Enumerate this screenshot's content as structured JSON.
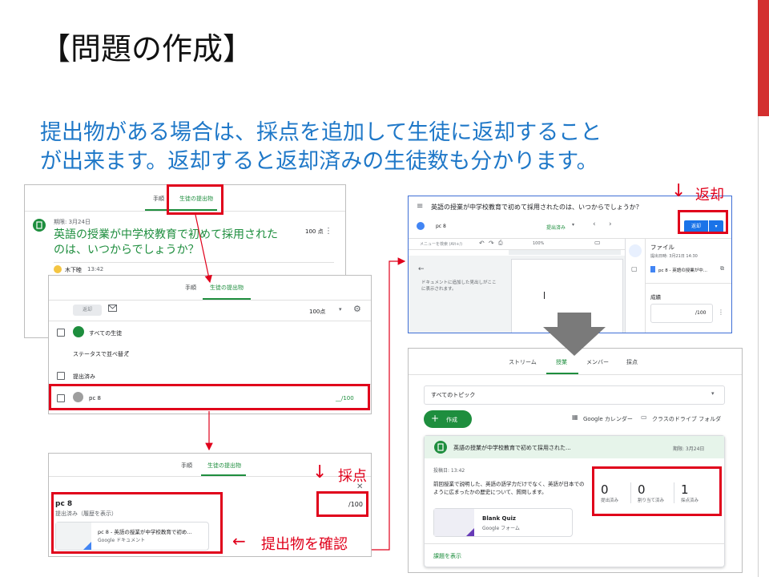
{
  "slide": {
    "title": "【問題の作成】",
    "body_line1": "提出物がある場合は、採点を追加して生徒に返却すること",
    "body_line2": "が出来ます。返却すると返却済みの生徒数も分かります。",
    "accent_color": "#d32f2f"
  },
  "shot1": {
    "tab_instructions": "手順",
    "tab_submissions": "生徒の提出物",
    "due": "期限: 3月24日",
    "title_line1": "英語の授業が中学校教育で初めて採用された",
    "title_line2": "のは、いつからでしょうか？",
    "points": "100 点",
    "author": "木下睦",
    "time": "13:42"
  },
  "shot2": {
    "tab_instructions": "手順",
    "tab_submissions": "生徒の提出物",
    "return_button": "返却",
    "points_select": "100点",
    "all_students": "すべての生徒",
    "sort_label": "ステータスで並べ替え",
    "section_submitted": "提出済み",
    "student_name": "pc 8",
    "grade_value": "__/100"
  },
  "shot3": {
    "tab_instructions": "手順",
    "tab_submissions": "生徒の提出物",
    "student_name": "pc 8",
    "status": "提出済み（履歴を表示）",
    "grade": "/100",
    "attachment_title": "pc 8 - 英語の授業が中学校教育で初め...",
    "attachment_type": "Google ドキュメント"
  },
  "shot4": {
    "title": "英語の授業が中学校教育で初めて採用されたのは、いつからでしょうか？",
    "student": "pc 8",
    "status": "提出済み",
    "return_button": "返却",
    "menu_search": "メニューを検索 (Alt+/)",
    "zoom": "100%",
    "outline_text": "ドキュメントに追加した見出しがここに表示されます。",
    "files_label": "ファイル",
    "submitted_date": "提出日時: 3月21日 14:30",
    "file_name": "pc 8 - 英語の授業が中...",
    "grade_label": "成績",
    "grade_value": "/100"
  },
  "shot5": {
    "tab_stream": "ストリーム",
    "tab_classwork": "授業",
    "tab_people": "メンバー",
    "tab_grades": "採点",
    "topic_select": "すべてのトピック",
    "create_button": "作成",
    "calendar_link": "Google カレンダー",
    "drive_link": "クラスのドライブ フォルダ",
    "assignment_title": "英語の授業が中学校教育で初めて採用された...",
    "due": "期限: 3月24日",
    "posted": "投稿日: 13:42",
    "desc_line1": "前回授業で説明した、英語の語学力だけでなく、英語が日本での",
    "desc_line2": "ように広まったかの歴史について、質問します。",
    "stats": [
      {
        "value": "0",
        "label": "提出済み"
      },
      {
        "value": "0",
        "label": "割り当て済み"
      },
      {
        "value": "1",
        "label": "採点済み"
      }
    ],
    "quiz_title": "Blank Quiz",
    "quiz_type": "Google フォーム",
    "view_link": "課題を表示"
  },
  "callouts": {
    "return": "返却",
    "grading": "採点",
    "check": "提出物を確認",
    "down_arrow": "↓",
    "left_arrow": "←"
  }
}
